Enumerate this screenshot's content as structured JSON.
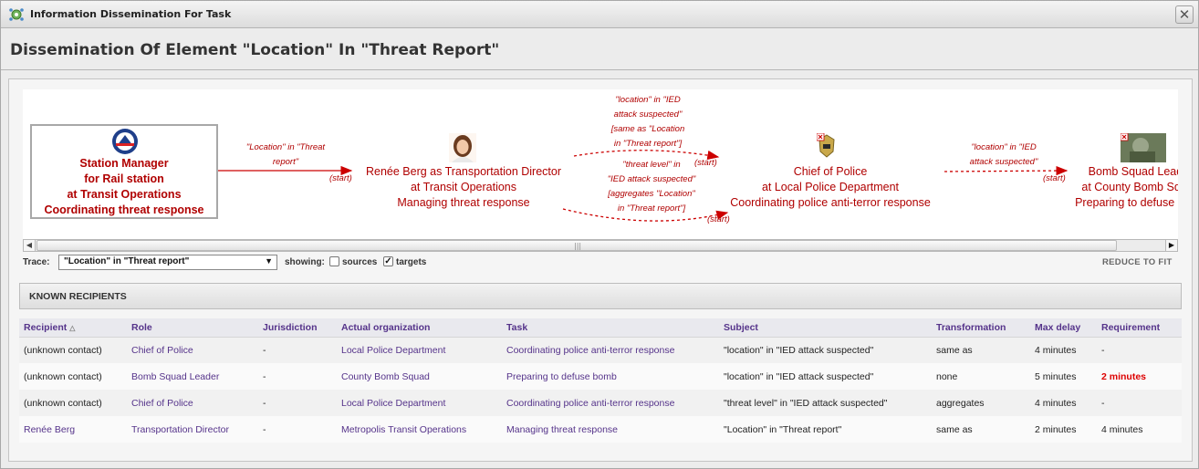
{
  "window": {
    "title": "Information Dissemination For Task",
    "close_glyph": "✕",
    "icon": "gear-network-icon"
  },
  "page": {
    "title": "Dissemination Of Element \"Location\" In \"Threat Report\""
  },
  "flow": {
    "source": {
      "lines": [
        "Station Manager",
        "for Rail station",
        "at Transit Operations",
        "Coordinating threat response"
      ],
      "icon": "transit-logo-icon"
    },
    "nodes": [
      {
        "lines": [
          "Renée Berg as Transportation Director",
          "at Transit Operations",
          "Managing threat response"
        ],
        "icon": "person-photo-icon"
      },
      {
        "lines": [
          "Chief of Police",
          "at Local Police Department",
          "Coordinating police anti-terror response"
        ],
        "icon": "police-badge-icon"
      },
      {
        "lines": [
          "Bomb Squad Leader",
          "at County Bomb Squad",
          "Preparing to defuse bomb"
        ],
        "icon": "bomb-squad-photo-icon"
      }
    ],
    "edges": [
      {
        "label": [
          "\"Location\" in \"Threat",
          "report\""
        ],
        "start": "(start)"
      },
      {
        "label": [
          "\"location\" in \"IED",
          "attack suspected\"",
          "[same as \"Location",
          "in \"Threat report\"]"
        ],
        "start": "(start)"
      },
      {
        "label": [
          "\"threat level\" in",
          "\"IED attack suspected\"",
          "[aggregates \"Location\"",
          "in \"Threat report\"]"
        ],
        "start": "(start)"
      },
      {
        "label": [
          "\"location\" in \"IED",
          "attack suspected\""
        ],
        "start": "(start)"
      }
    ]
  },
  "scroll": {
    "left_arrow": "◀",
    "right_arrow": "▶",
    "grip": "|||"
  },
  "trace": {
    "label": "Trace:",
    "selected": "\"Location\" in \"Threat report\"",
    "arrow": "▼",
    "showing_label": "showing:",
    "sources_label": "sources",
    "sources_checked": false,
    "targets_label": "targets",
    "targets_checked": true,
    "check_glyph": "✓",
    "reduce_label": "REDUCE TO FIT"
  },
  "recipients": {
    "header": "KNOWN RECIPIENTS",
    "sort_glyph": "△",
    "columns": [
      "Recipient",
      "Role",
      "Jurisdiction",
      "Actual organization",
      "Task",
      "Subject",
      "Transformation",
      "Max delay",
      "Requirement"
    ],
    "rows": [
      {
        "recipient": "(unknown contact)",
        "role": "Chief of Police",
        "jurisdiction": "-",
        "organization": "Local Police Department",
        "task": "Coordinating police anti-terror response",
        "subject": "\"location\" in \"IED attack suspected\"",
        "transformation": "same as",
        "max_delay": "4 minutes",
        "requirement": "-"
      },
      {
        "recipient": "(unknown contact)",
        "role": "Bomb Squad Leader",
        "jurisdiction": "-",
        "organization": "County Bomb Squad",
        "task": "Preparing to defuse bomb",
        "subject": "\"location\" in \"IED attack suspected\"",
        "transformation": "none",
        "max_delay": "5 minutes",
        "requirement": "2 minutes"
      },
      {
        "recipient": "(unknown contact)",
        "role": "Chief of Police",
        "jurisdiction": "-",
        "organization": "Local Police Department",
        "task": "Coordinating police anti-terror response",
        "subject": "\"threat level\" in \"IED attack suspected\"",
        "transformation": "aggregates",
        "max_delay": "4 minutes",
        "requirement": "-"
      },
      {
        "recipient": "Renée Berg",
        "role": "Transportation Director",
        "jurisdiction": "-",
        "organization": "Metropolis Transit Operations",
        "task": "Managing threat response",
        "subject": "\"Location\" in \"Threat report\"",
        "transformation": "same as",
        "max_delay": "2 minutes",
        "requirement": "4 minutes"
      }
    ]
  },
  "colors": {
    "flow_red": "#b00000",
    "link_purple": "#55338a",
    "requirement_red": "#dd0000"
  }
}
